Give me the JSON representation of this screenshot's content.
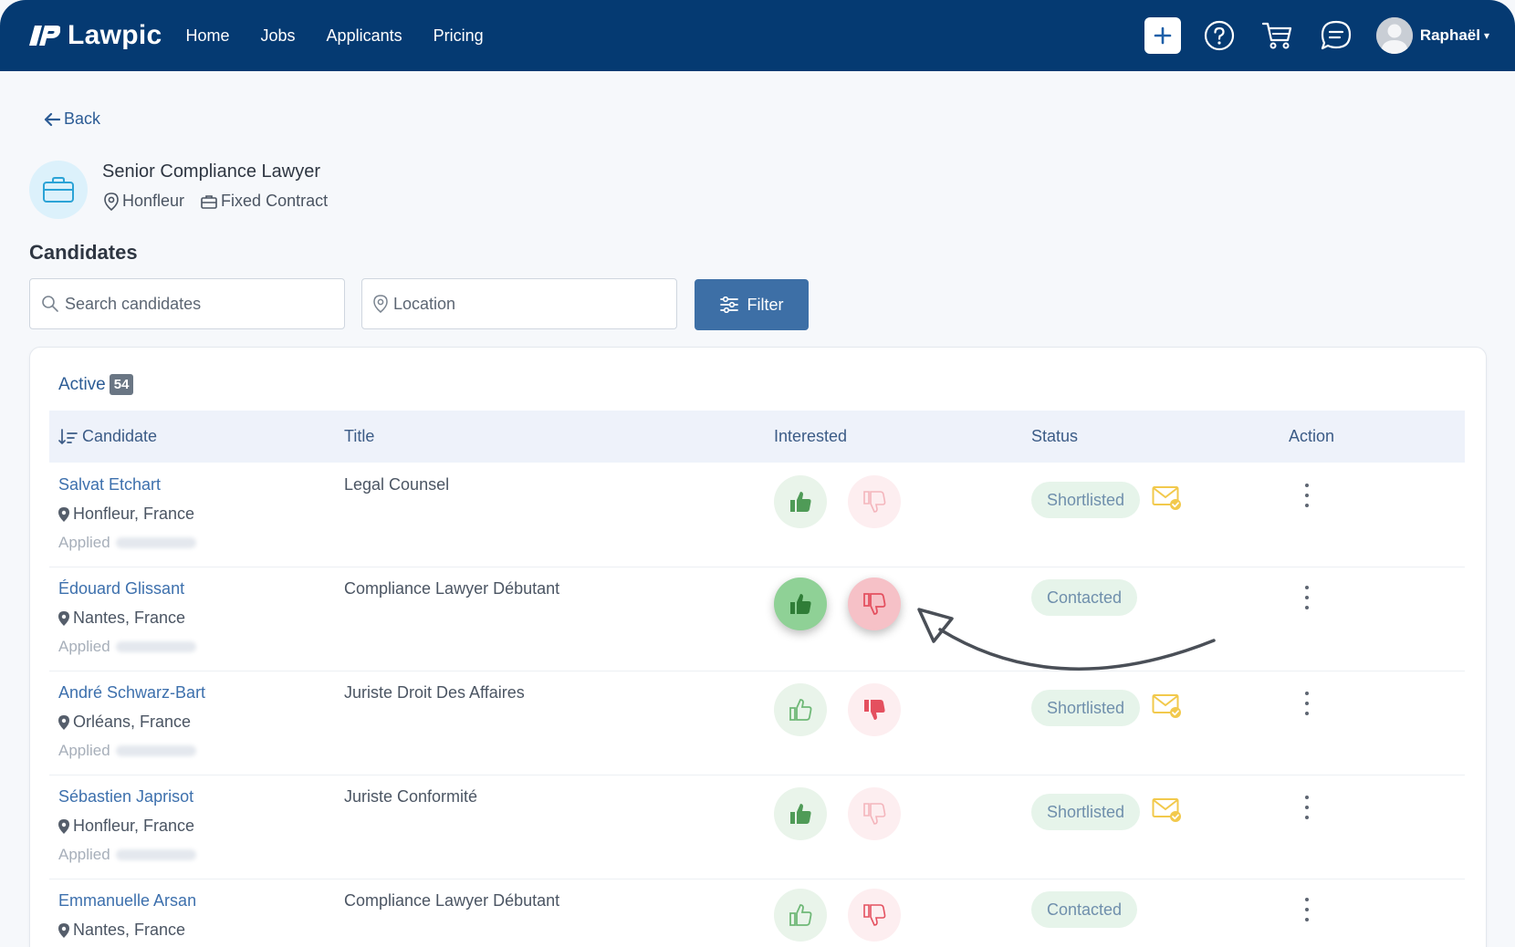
{
  "brand": {
    "name": "Lawpic"
  },
  "nav": {
    "items": [
      "Home",
      "Jobs",
      "Applicants",
      "Pricing"
    ]
  },
  "user": {
    "name": "Raphaël"
  },
  "back_label": "Back",
  "job": {
    "title": "Senior Compliance Lawyer",
    "location": "Honfleur",
    "contract": "Fixed Contract"
  },
  "section_title": "Candidates",
  "search": {
    "placeholder": "Search candidates"
  },
  "location_filter": {
    "placeholder": "Location"
  },
  "filter_label": "Filter",
  "tab": {
    "label": "Active",
    "count": "54"
  },
  "table": {
    "columns": [
      "Candidate",
      "Title",
      "Interested",
      "Status",
      "Action"
    ],
    "rows": [
      {
        "name": "Salvat Etchart",
        "location": "Honfleur, France",
        "applied": "Applied",
        "title": "Legal Counsel",
        "status": "Shortlisted",
        "mail": true
      },
      {
        "name": "Édouard Glissant",
        "location": "Nantes, France",
        "applied": "Applied",
        "title": "Compliance Lawyer Débutant",
        "status": "Contacted",
        "mail": false
      },
      {
        "name": "André Schwarz-Bart",
        "location": "Orléans, France",
        "applied": "Applied",
        "title": "Juriste Droit Des Affaires",
        "status": "Shortlisted",
        "mail": true
      },
      {
        "name": "Sébastien Japrisot",
        "location": "Honfleur, France",
        "applied": "Applied",
        "title": "Juriste Conformité",
        "status": "Shortlisted",
        "mail": true
      },
      {
        "name": "Emmanuelle Arsan",
        "location": "Nantes, France",
        "applied": "Applied",
        "title": "Compliance Lawyer Débutant",
        "status": "Contacted",
        "mail": false
      }
    ]
  },
  "colors": {
    "nav_bg": "#053a72",
    "link": "#3d70ad",
    "filter_btn": "#3d6fa6",
    "thumb_up": "#4f9b57",
    "thumb_down": "#e4505f",
    "mail": "#f2c94c"
  }
}
